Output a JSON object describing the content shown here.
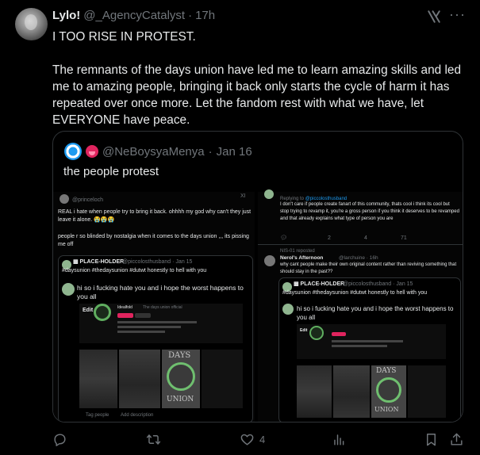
{
  "tweet": {
    "display_name": "Lylo!",
    "handle": "@_AgencyCatalyst",
    "separator": "·",
    "time": "17h",
    "more_label": "···",
    "text_line1": "I TOO RISE IN PROTEST.",
    "text_line2": "The remnants of the days union have led me to learn amazing skills and led me to amazing people, bringing it back only starts the cycle of harm it has repeated over once more. Let the fandom rest with what we have, let EVERYONE have peace."
  },
  "quote": {
    "handle": "@NeBoysyaMenya",
    "separator": "·",
    "time": "Jan 16",
    "text": "the people protest"
  },
  "screenshot": {
    "left_user": "@princeloch",
    "left_text1": "REAL i hate when people try to bring it back. ohhhh my god why can't they just leave it alone. 😭😭😭",
    "left_text2": "people r so blinded by nostalgia when it comes to the days union ,,, its pissing me off",
    "placeholder_name": "▩ PLACE-HOLDER",
    "placeholder_handle": "@piccolosthusband · Jan 15",
    "hashtags": "#daysunion #thedaysunion #dutwt honestly to hell with you",
    "hate_text": "hi so i fucking hate you and i hope the worst happens to you all",
    "profile_name": "Idealfold",
    "profile_sub": "The days union official",
    "edit_label": "Edit",
    "days_text": "DAYS",
    "union_text": "UNION",
    "tag_people": "Tag people",
    "add_description": "Add description",
    "reply_to": "Replying to @piccolosthusband",
    "right_text1": "I don't care if people create fanart of this community, thats cool i think its cool but stop trying to revamp it, you're a gross person if you think it deserves to be revamped and that already explains what type of person you are",
    "right_count_rt": "2",
    "right_count_like": "4",
    "right_count_views": "71",
    "reposted": "NIS-01 reposted",
    "nerol_name": "Nerol's Afternoon",
    "nerol_handle": "@larchuine · 16h",
    "nerol_text": "why cant people make their own original content rather than reviving something that should stay in the past??",
    "left_icon_label": "XI"
  },
  "actions": {
    "reply_count": "",
    "retweet_count": "",
    "like_count": "4",
    "views_count": ""
  },
  "icons": [
    "grok-icon",
    "more-icon",
    "reply-icon",
    "retweet-icon",
    "like-icon",
    "views-icon",
    "bookmark-icon",
    "share-icon"
  ],
  "colors": {
    "background": "#000000",
    "text": "#e7e9ea",
    "muted": "#71767b",
    "border": "#2f3336",
    "link": "#1d9bf0"
  }
}
